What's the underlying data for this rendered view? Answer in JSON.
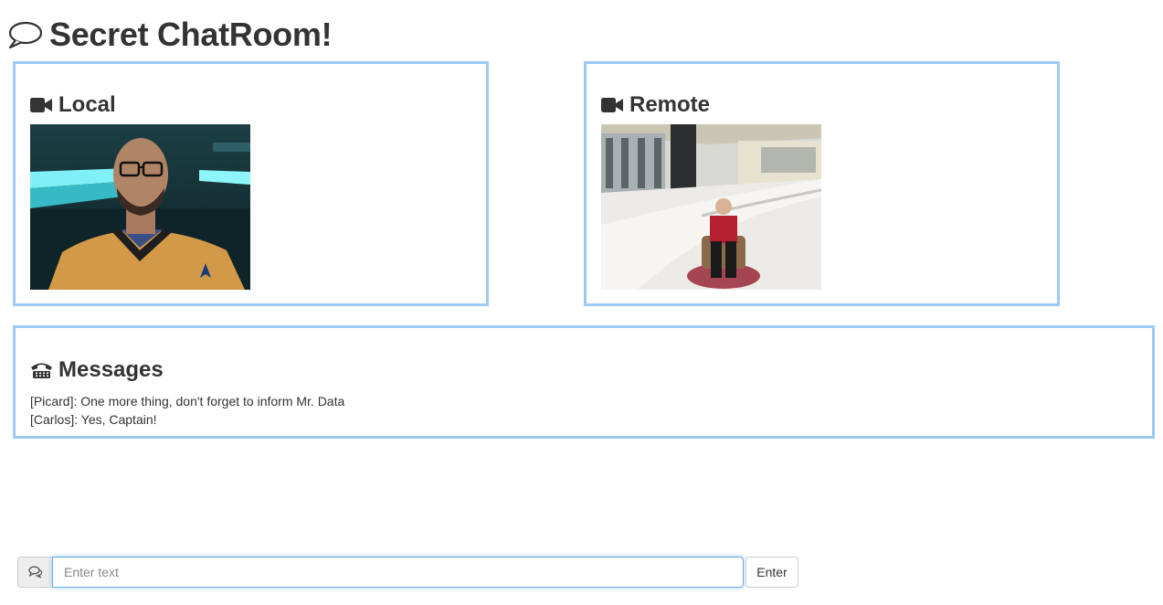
{
  "page": {
    "title": "Secret ChatRoom!"
  },
  "icons": {
    "title": "speech-bubble-icon",
    "local": "video-camera-icon",
    "remote": "video-camera-icon",
    "messages": "telephone-icon",
    "input_addon": "chat-bubbles-icon"
  },
  "colors": {
    "panel_border": "#9ccaf5",
    "input_focus": "#66afe9",
    "text": "#333333"
  },
  "panels": {
    "local": {
      "heading": "Local"
    },
    "remote": {
      "heading": "Remote"
    },
    "messages": {
      "heading": "Messages",
      "items": [
        "[Picard]: One more thing, don't forget to inform Mr. Data",
        "[Carlos]: Yes, Captain!"
      ]
    }
  },
  "composer": {
    "placeholder": "Enter text",
    "value": "",
    "send_label": "Enter"
  }
}
